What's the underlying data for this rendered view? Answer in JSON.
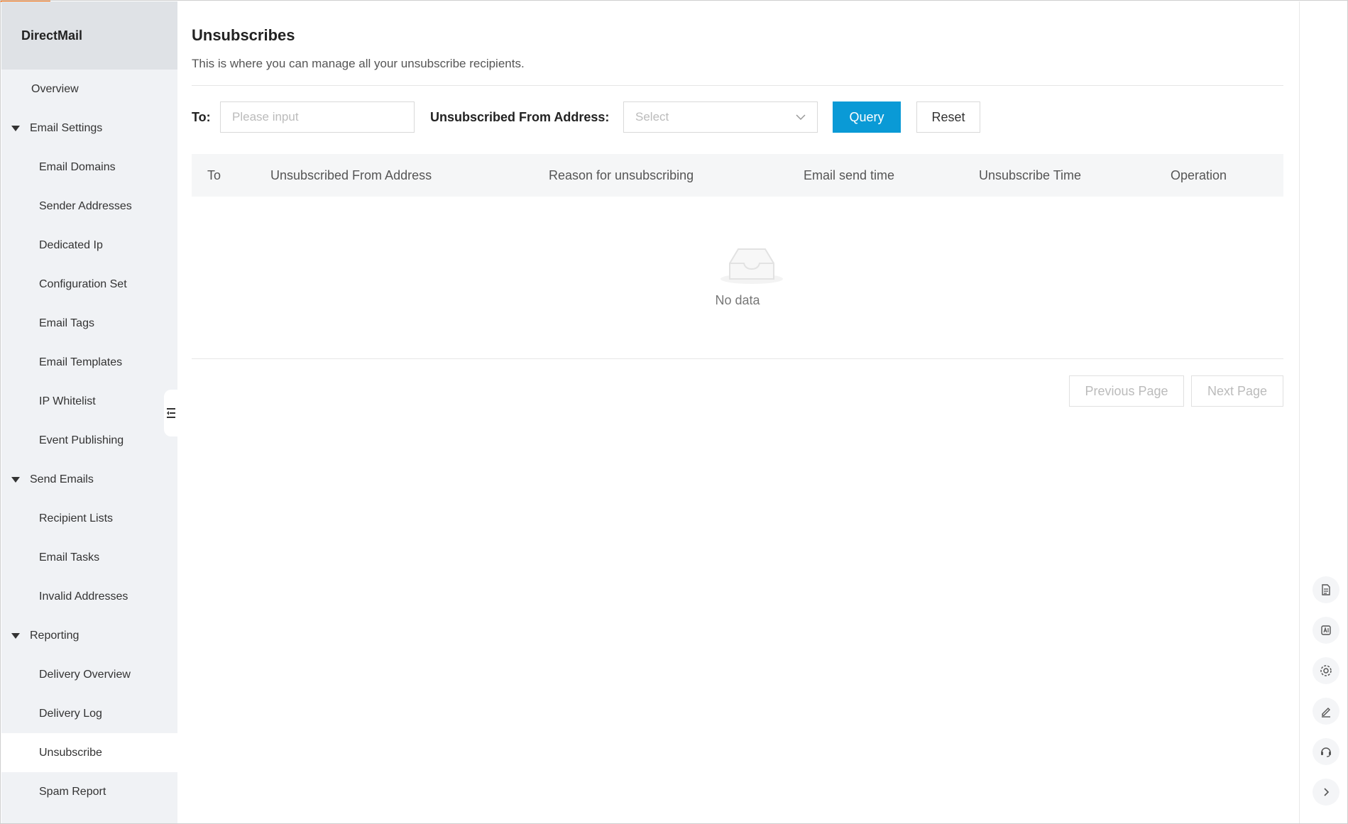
{
  "sidebar": {
    "brand": "DirectMail",
    "overview": "Overview",
    "groups": [
      {
        "label": "Email Settings",
        "items": [
          "Email Domains",
          "Sender Addresses",
          "Dedicated Ip",
          "Configuration Set",
          "Email Tags",
          "Email Templates",
          "IP Whitelist",
          "Event Publishing"
        ]
      },
      {
        "label": "Send Emails",
        "items": [
          "Recipient Lists",
          "Email Tasks",
          "Invalid Addresses"
        ]
      },
      {
        "label": "Reporting",
        "items": [
          "Delivery Overview",
          "Delivery Log",
          "Unsubscribe",
          "Spam Report"
        ]
      }
    ],
    "active_item": "Unsubscribe"
  },
  "page": {
    "title": "Unsubscribes",
    "description": "This is where you can manage all your unsubscribe recipients."
  },
  "filters": {
    "to_label": "To",
    "to_placeholder": "Please input",
    "from_label": "Unsubscribed From Address",
    "from_placeholder": "Select",
    "colon": ":",
    "query_label": "Query",
    "reset_label": "Reset"
  },
  "table": {
    "columns": [
      "To",
      "Unsubscribed From Address",
      "Reason for unsubscribing",
      "Email send time",
      "Unsubscribe Time",
      "Operation"
    ],
    "empty_text": "No data"
  },
  "pagination": {
    "prev_label": "Previous Page",
    "next_label": "Next Page"
  },
  "colors": {
    "primary": "#0a9ad6",
    "accent": "#ff6a00"
  },
  "right_toolbar": {
    "icons": [
      "document-icon",
      "api-icon",
      "settings-icon",
      "edit-icon",
      "headset-icon",
      "chevron-right-icon"
    ]
  }
}
